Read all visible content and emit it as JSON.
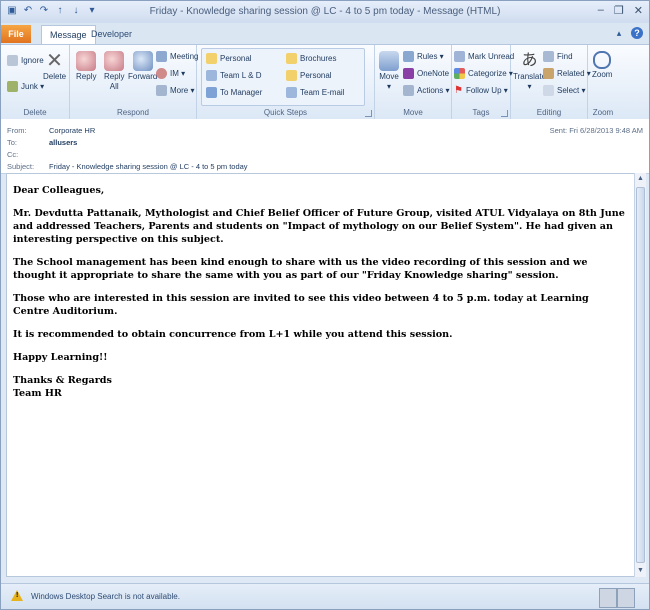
{
  "window": {
    "title": "Friday - Knowledge sharing session @ LC - 4 to 5 pm today  -  Message (HTML)",
    "quick_access_icons": [
      "save-icon",
      "undo-icon",
      "redo-icon",
      "up-arrow-icon",
      "down-arrow-icon",
      "customize-icon"
    ],
    "controls": {
      "minimize": "–",
      "restore": "❐",
      "close": "✕"
    }
  },
  "tabs": {
    "file": "File",
    "message": "Message",
    "developer": "Developer"
  },
  "ribbon": {
    "delete_group": {
      "label": "Delete",
      "ignore": "Ignore",
      "junk": "Junk ▾",
      "delete": "Delete"
    },
    "respond_group": {
      "label": "Respond",
      "reply": "Reply",
      "reply_all_1": "Reply",
      "reply_all_2": "All",
      "forward": "Forward",
      "meeting": "Meeting",
      "im": "IM ▾",
      "more": "More ▾"
    },
    "quick_steps": {
      "label": "Quick Steps",
      "items": [
        "Personal",
        "Brochures",
        "Team L & D",
        "Personal",
        "To Manager",
        "Team E-mail"
      ]
    },
    "move_group": {
      "label": "Move",
      "move": "Move",
      "move_arrow": "▾",
      "rules": "Rules ▾",
      "onenote": "OneNote",
      "actions": "Actions ▾"
    },
    "tags_group": {
      "label": "Tags",
      "mark_unread": "Mark Unread",
      "categorize": "Categorize ▾",
      "follow_up": "Follow Up ▾"
    },
    "editing_group": {
      "label": "Editing",
      "translate": "Translate",
      "translate_arrow": "▾",
      "find": "Find",
      "related": "Related ▾",
      "select": "Select ▾"
    },
    "zoom_group": {
      "label": "Zoom",
      "zoom": "Zoom"
    }
  },
  "header": {
    "from_label": "From:",
    "from_value": "Corporate HR",
    "to_label": "To:",
    "to_value": "allusers",
    "cc_label": "Cc:",
    "subject_label": "Subject:",
    "subject_value": "Friday - Knowledge sharing session @ LC - 4 to 5 pm today",
    "sent_label": "Sent:",
    "sent_value": "Fri 6/28/2013 9:48 AM"
  },
  "body": {
    "greeting": "Dear Colleagues,",
    "p1": "Mr. Devdutta Pattanaik, Mythologist and Chief Belief Officer of Future Group, visited ATUL Vidyalaya on 8th June and addressed Teachers, Parents and students on \"Impact of mythology on our Belief System\". He had given an interesting perspective on this subject.",
    "p2": "The School management has been kind enough to share with us the video recording of this session and we thought it appropriate to share the same with you as part of our \"Friday Knowledge sharing\" session.",
    "p3": "Those who are interested in this session are invited to see this video between 4 to 5 p.m. today at Learning Centre Auditorium.",
    "p4": "It is recommended to obtain concurrence from L+1 while you attend this session.",
    "p5": "Happy Learning!!",
    "sign1": "Thanks & Regards",
    "sign2": "Team HR"
  },
  "status": {
    "text": "Windows Desktop Search is not available."
  }
}
